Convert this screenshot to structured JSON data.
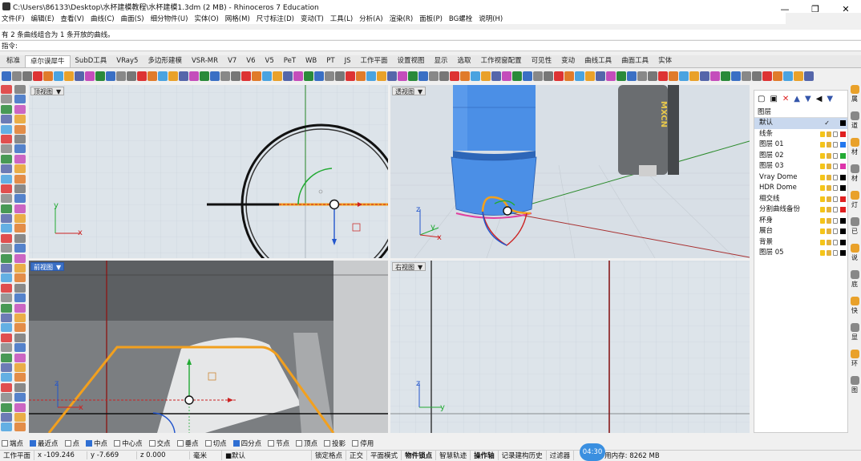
{
  "window": {
    "title": "C:\\Users\\86133\\Desktop\\水杯建模教程\\水杯建模1.3dm (2 MB) - Rhinoceros 7 Education",
    "minimize": "—",
    "maximize": "❐",
    "close": "✕"
  },
  "menu": [
    "文件(F)",
    "编辑(E)",
    "查看(V)",
    "曲线(C)",
    "曲面(S)",
    "细分物件(U)",
    "实体(O)",
    "网格(M)",
    "尺寸标注(D)",
    "变动(T)",
    "工具(L)",
    "分析(A)",
    "渲染(R)",
    "面板(P)",
    "BG螺栓",
    "说明(H)"
  ],
  "command": {
    "history": "有 2 条曲线组合为 1 条开放的曲线。",
    "prompt": "指令:"
  },
  "tabs": [
    "标准",
    "卓尔谟犀牛",
    "SubD工具",
    "VRay5",
    "多边形建模",
    "VSR-MR",
    "V7",
    "V6",
    "V5",
    "PeT",
    "WB",
    "PT",
    "JS",
    "工作平面",
    "设置视图",
    "显示",
    "选取",
    "工作视窗配置",
    "可见性",
    "变动",
    "曲线工具",
    "曲面工具",
    "实体"
  ],
  "viewports": {
    "top": "顶视图",
    "perspective": "透视图",
    "front": "前视图",
    "right": "右视图",
    "arrow": "▼"
  },
  "axes": {
    "x": "x",
    "y": "y",
    "z": "z"
  },
  "brand_text": "MXCN",
  "layers": {
    "header": "图层",
    "items": [
      {
        "name": "默认",
        "color": "#000000",
        "selected": true
      },
      {
        "name": "线条",
        "color": "#e02020"
      },
      {
        "name": "图层 01",
        "color": "#2277ee"
      },
      {
        "name": "图层 02",
        "color": "#22aa33"
      },
      {
        "name": "图层 03",
        "color": "#dd33aa"
      },
      {
        "name": "Vray Dome",
        "color": "#000000"
      },
      {
        "name": "HDR Dome",
        "color": "#000000"
      },
      {
        "name": "相交线",
        "color": "#e02020"
      },
      {
        "name": "分割曲线备份",
        "color": "#e02020"
      },
      {
        "name": "杯身",
        "color": "#000000"
      },
      {
        "name": "展台",
        "color": "#000000"
      },
      {
        "name": "背景",
        "color": "#000000"
      },
      {
        "name": "图层 05",
        "color": "#000000"
      }
    ]
  },
  "right_panel": [
    "属",
    "道",
    "材",
    "材",
    "灯",
    "已",
    "说",
    "底",
    "快",
    "显",
    "环",
    "图"
  ],
  "osnap": [
    {
      "label": "端点",
      "on": false
    },
    {
      "label": "最近点",
      "on": true
    },
    {
      "label": "点",
      "on": false
    },
    {
      "label": "中点",
      "on": true
    },
    {
      "label": "中心点",
      "on": false
    },
    {
      "label": "交点",
      "on": false
    },
    {
      "label": "垂点",
      "on": false
    },
    {
      "label": "切点",
      "on": false
    },
    {
      "label": "四分点",
      "on": true
    },
    {
      "label": "节点",
      "on": false
    },
    {
      "label": "顶点",
      "on": false
    },
    {
      "label": "投影",
      "on": false
    },
    {
      "label": "停用",
      "on": false
    }
  ],
  "status": {
    "cplane": "工作平面",
    "x": "x -109.246",
    "y": "y -7.669",
    "z": "z 0.000",
    "units": "毫米",
    "layer": "■默认",
    "items": [
      "锁定格点",
      "正交",
      "平面模式",
      "物件锁点",
      "智慧轨迹",
      "操作轴",
      "记录建构历史",
      "过滤器"
    ],
    "memory": "用内存: 8262 MB",
    "clock": "04:30"
  },
  "colors": {
    "accent": "#3a6fc4",
    "cup": "#4b8fe6",
    "orange_curve": "#f2a01e",
    "red_axis": "#cc2222"
  }
}
